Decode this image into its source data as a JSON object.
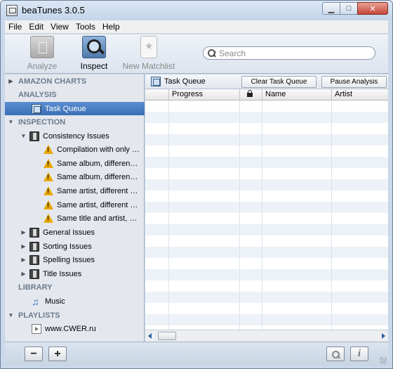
{
  "window": {
    "title": "beaTunes 3.0.5",
    "minimize": "▁",
    "maximize": "□",
    "close": "✕"
  },
  "menu": [
    "File",
    "Edit",
    "View",
    "Tools",
    "Help"
  ],
  "toolbar": {
    "analyze": "Analyze",
    "inspect": "Inspect",
    "new_matchlist": "New Matchlist",
    "search_placeholder": "Search"
  },
  "sidebar": {
    "amazon_charts": "AMAZON CHARTS",
    "analysis": "ANALYSIS",
    "task_queue": "Task Queue",
    "inspection": "INSPECTION",
    "consistency_issues": "Consistency Issues",
    "consistency_children": [
      "Compilation with only one artist",
      "Same album, different artist",
      "Same album, different genre",
      "Same artist, different genre",
      "Same artist, different spelling",
      "Same title and artist, different album"
    ],
    "general_issues": "General Issues",
    "sorting_issues": "Sorting Issues",
    "spelling_issues": "Spelling Issues",
    "title_issues": "Title Issues",
    "library": "LIBRARY",
    "music": "Music",
    "playlists": "PLAYLISTS",
    "playlist_item": "www.CWER.ru"
  },
  "main": {
    "title": "Task Queue",
    "clear_button": "Clear Task Queue",
    "pause_button": "Pause Analysis",
    "columns": {
      "progress": "Progress",
      "name": "Name",
      "artist": "Artist"
    }
  },
  "bottom": {
    "minus": "−",
    "plus": "+",
    "info": "i"
  }
}
